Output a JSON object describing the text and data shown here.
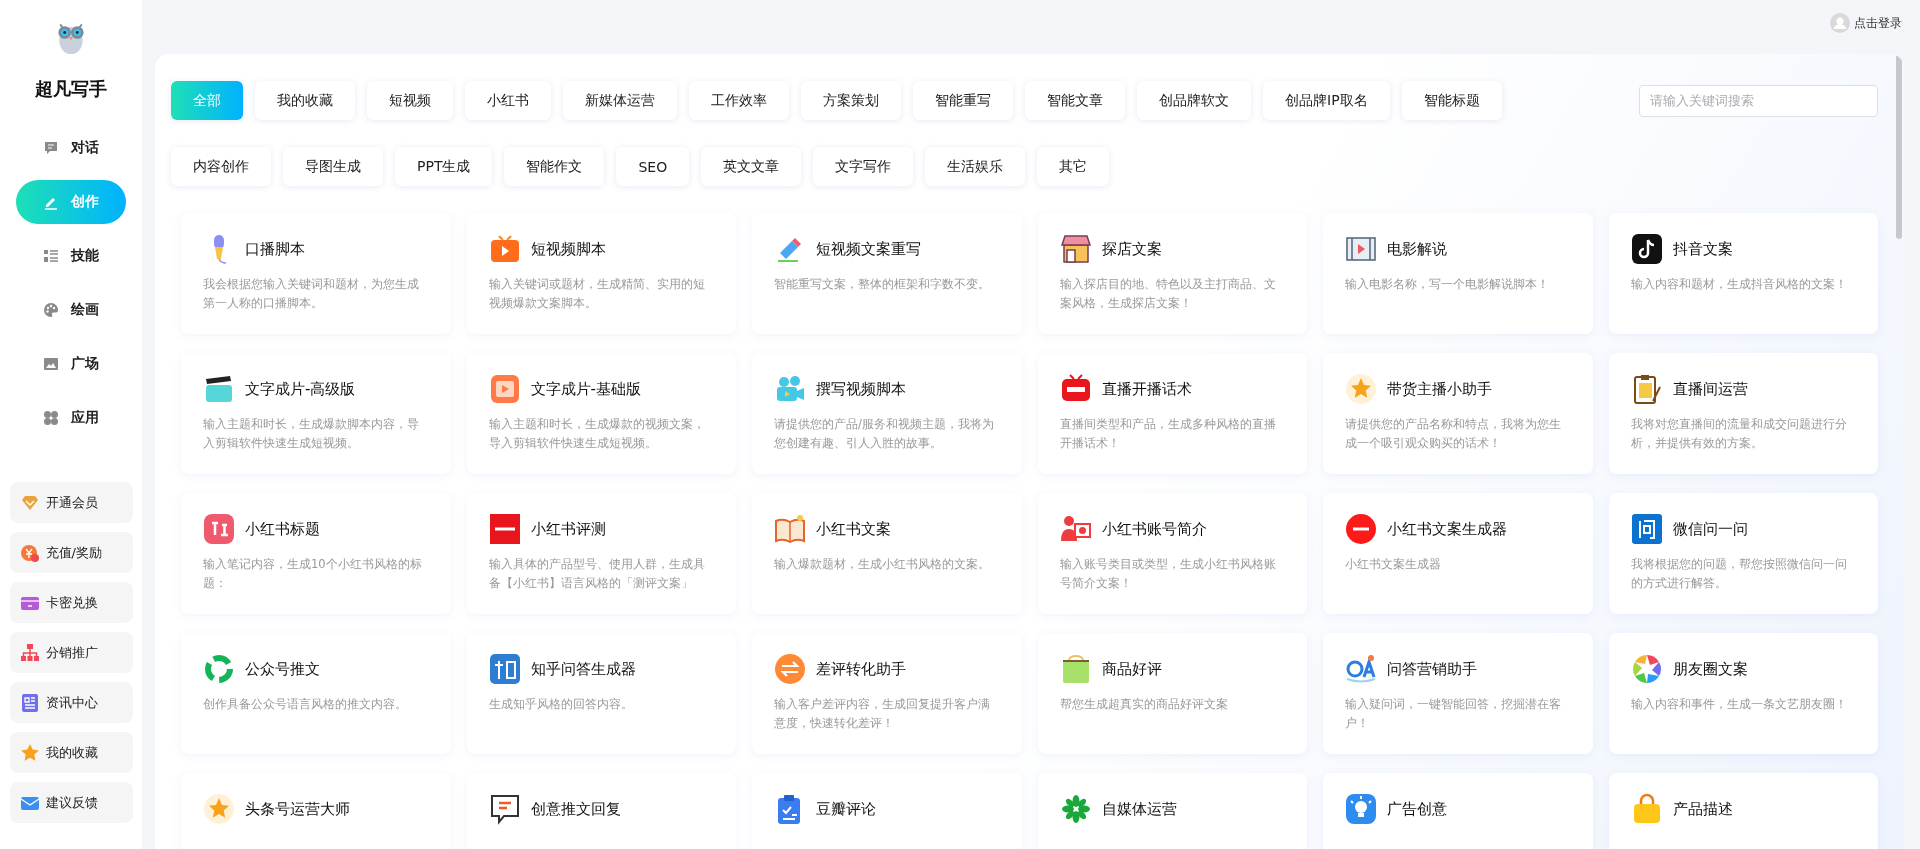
{
  "app": {
    "name": "超凡写手"
  },
  "nav": [
    {
      "label": "对话",
      "selected": false
    },
    {
      "label": "创作",
      "selected": true
    },
    {
      "label": "技能",
      "selected": false
    },
    {
      "label": "绘画",
      "selected": false
    },
    {
      "label": "广场",
      "selected": false
    },
    {
      "label": "应用",
      "selected": false
    }
  ],
  "sidebar_buttons": [
    "开通会员",
    "充值/奖励",
    "卡密兑换",
    "分销推广",
    "资讯中心",
    "我的收藏",
    "建议反馈"
  ],
  "user": {
    "login": "点击登录"
  },
  "category_rows": [
    {
      "tabs": [
        {
          "label": "全部",
          "selected": true
        },
        {
          "label": "我的收藏",
          "selected": false
        },
        {
          "label": "短视频",
          "selected": false
        },
        {
          "label": "小红书",
          "selected": false
        },
        {
          "label": "新媒体运营",
          "selected": false
        },
        {
          "label": "工作效率",
          "selected": false
        },
        {
          "label": "方案策划",
          "selected": false
        },
        {
          "label": "智能重写",
          "selected": false
        },
        {
          "label": "智能文章",
          "selected": false
        },
        {
          "label": "创品牌软文",
          "selected": false
        },
        {
          "label": "创品牌IP取名",
          "selected": false
        },
        {
          "label": "智能标题",
          "selected": false
        }
      ]
    },
    {
      "tabs": [
        {
          "label": "内容创作",
          "selected": false
        },
        {
          "label": "导图生成",
          "selected": false
        },
        {
          "label": "PPT生成",
          "selected": false
        },
        {
          "label": "智能作文",
          "selected": false
        },
        {
          "label": "SEO",
          "selected": false
        },
        {
          "label": "英文文章",
          "selected": false
        },
        {
          "label": "文字写作",
          "selected": false
        },
        {
          "label": "生活娱乐",
          "selected": false
        },
        {
          "label": "其它",
          "selected": false
        }
      ]
    }
  ],
  "search": {
    "placeholder": "请输入关键词搜索"
  },
  "cards": [
    {
      "title": "口播脚本",
      "desc": "我会根据您输入关键词和题材，为您生成第一人称的口播脚本。"
    },
    {
      "title": "短视频脚本",
      "desc": "输入关键词或题材，生成精简、实用的短视频爆款文案脚本。"
    },
    {
      "title": "短视频文案重写",
      "desc": "智能重写文案，整体的框架和字数不变。"
    },
    {
      "title": "探店文案",
      "desc": "输入探店目的地、特色以及主打商品、文案风格，生成探店文案！"
    },
    {
      "title": "电影解说",
      "desc": "输入电影名称，写一个电影解说脚本！"
    },
    {
      "title": "抖音文案",
      "desc": "输入内容和题材，生成抖音风格的文案！"
    },
    {
      "title": "文字成片-高级版",
      "desc": "输入主题和时长，生成爆款脚本内容，导入剪辑软件快速生成短视频。"
    },
    {
      "title": "文字成片-基础版",
      "desc": "输入主题和时长，生成爆款的视频文案，导入剪辑软件快速生成短视频。"
    },
    {
      "title": "撰写视频脚本",
      "desc": "请提供您的产品/服务和视频主题，我将为您创建有趣、引人入胜的故事。"
    },
    {
      "title": "直播开播话术",
      "desc": "直播间类型和产品，生成多种风格的直播开播话术！"
    },
    {
      "title": "带货主播小助手",
      "desc": "请提供您的产品名称和特点，我将为您生成一个吸引观众购买的话术！"
    },
    {
      "title": "直播间运营",
      "desc": "我将对您直播间的流量和成交问题进行分析，并提供有效的方案。"
    },
    {
      "title": "小红书标题",
      "desc": "输入笔记内容，生成10个小红书风格的标题："
    },
    {
      "title": "小红书评测",
      "desc": "输入具体的产品型号、使用人群，生成具备【小红书】语言风格的「测评文案」"
    },
    {
      "title": "小红书文案",
      "desc": "输入爆款题材，生成小红书风格的文案。"
    },
    {
      "title": "小红书账号简介",
      "desc": "输入账号类目或类型，生成小红书风格账号简介文案！"
    },
    {
      "title": "小红书文案生成器",
      "desc": "小红书文案生成器"
    },
    {
      "title": "微信问一问",
      "desc": "我将根据您的问题，帮您按照微信问一问的方式进行解答。"
    },
    {
      "title": "公众号推文",
      "desc": "创作具备公众号语言风格的推文内容。"
    },
    {
      "title": "知乎问答生成器",
      "desc": "生成知乎风格的回答内容。"
    },
    {
      "title": "差评转化助手",
      "desc": "输入客户差评内容，生成回复提升客户满意度，快速转化差评！"
    },
    {
      "title": "商品好评",
      "desc": "帮您生成超真实的商品好评文案"
    },
    {
      "title": "问答营销助手",
      "desc": "输入疑问词，一键智能回答，挖掘潜在客户！"
    },
    {
      "title": "朋友圈文案",
      "desc": "输入内容和事件，生成一条文艺朋友圈！"
    },
    {
      "title": "头条号运营大师"
    },
    {
      "title": "创意推文回复"
    },
    {
      "title": "豆瓣评论"
    },
    {
      "title": "自媒体运营"
    },
    {
      "title": "广告创意"
    },
    {
      "title": "产品描述"
    }
  ]
}
